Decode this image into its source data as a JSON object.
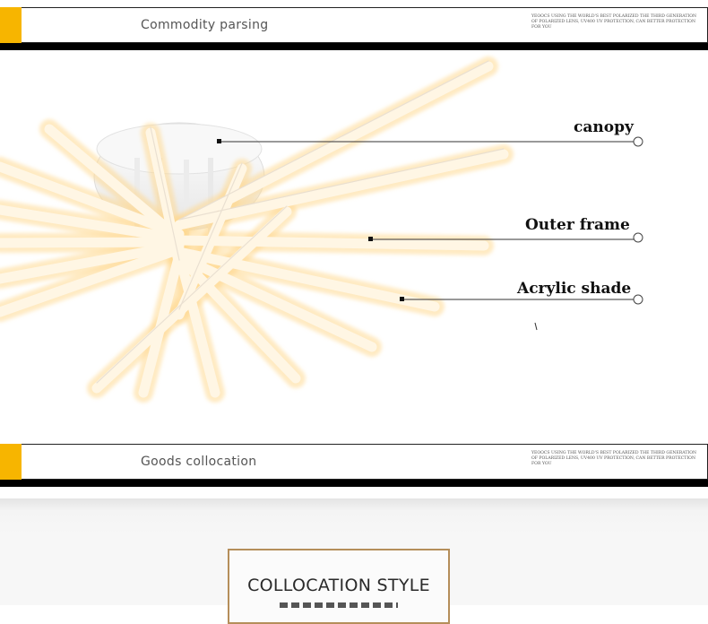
{
  "header_banner": {
    "title": "Commodity parsing",
    "fine_print": "YEOOCS USING THE WORLD'S BEST POLARIZED THE THIRD GENERATION OF POLARIZED LENS, UV400 UV PROTECTION, CAN BETTER PROTECTION FOR YOU"
  },
  "callouts": [
    {
      "label": "canopy"
    },
    {
      "label": "Outer frame"
    },
    {
      "label": "Acrylic shade"
    }
  ],
  "collocation_banner": {
    "title": "Goods collocation",
    "fine_print": "YEOOCS USING THE WORLD'S BEST POLARIZED THE THIRD GENERATION OF POLARIZED LENS, UV400 UV PROTECTION, CAN BETTER PROTECTION FOR YOU"
  },
  "collocation_style": {
    "title": "COLLOCATION STYLE"
  },
  "colors": {
    "accent": "#f7b500",
    "frame_gold": "#b58e5a",
    "lamp_glow": "#fff3d6"
  },
  "icons": {
    "callout_end": "circle-outline-icon",
    "callout_start": "square-dot-icon"
  }
}
